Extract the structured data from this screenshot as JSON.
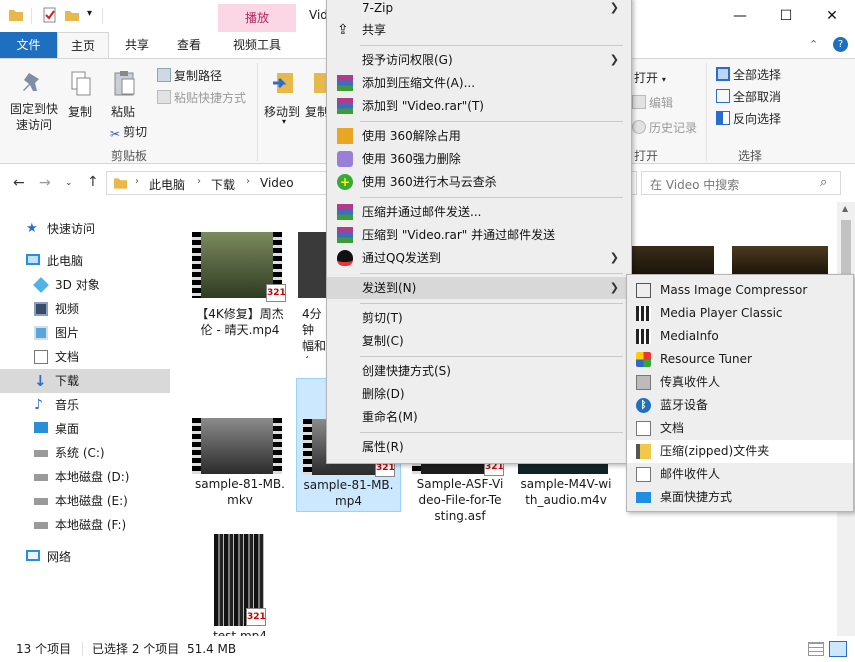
{
  "window": {
    "title": "Vid",
    "context_tab_group": "播放",
    "minimize": "—",
    "maximize": "☐",
    "close": "✕"
  },
  "ribbon_tabs": {
    "file": "文件",
    "home": "主页",
    "share": "共享",
    "view": "查看",
    "video_tools": "视频工具"
  },
  "ribbon": {
    "pin_quick_access": "固定到快速访问",
    "copy": "复制",
    "paste": "粘贴",
    "copy_path": "复制路径",
    "paste_shortcut": "粘贴快捷方式",
    "cut": "剪切",
    "clipboard_group": "剪贴板",
    "move_to": "移动到",
    "copy_to": "复制",
    "open": "打开",
    "edit": "编辑",
    "history": "历史记录",
    "open_group": "打开",
    "select_all": "全部选择",
    "select_none": "全部取消",
    "invert_selection": "反向选择",
    "select_group": "选择"
  },
  "address": {
    "crumbs": [
      "此电脑",
      "下载",
      "Video"
    ],
    "search_placeholder": "在 Video 中搜索"
  },
  "sidebar": {
    "items": [
      {
        "label": "快速访问",
        "icon": "star-icon"
      },
      {
        "label": "此电脑",
        "icon": "computer-icon"
      },
      {
        "label": "3D 对象",
        "icon": "cube-icon"
      },
      {
        "label": "视频",
        "icon": "video-folder-icon"
      },
      {
        "label": "图片",
        "icon": "picture-folder-icon"
      },
      {
        "label": "文档",
        "icon": "document-folder-icon"
      },
      {
        "label": "下载",
        "icon": "download-icon"
      },
      {
        "label": "音乐",
        "icon": "music-icon"
      },
      {
        "label": "桌面",
        "icon": "desktop-icon"
      },
      {
        "label": "系统 (C:)",
        "icon": "drive-icon"
      },
      {
        "label": "本地磁盘 (D:)",
        "icon": "drive-icon"
      },
      {
        "label": "本地磁盘 (E:)",
        "icon": "drive-icon"
      },
      {
        "label": "本地磁盘 (F:)",
        "icon": "drive-icon"
      },
      {
        "label": "网络",
        "icon": "network-icon"
      }
    ]
  },
  "files": [
    {
      "name_line1": "【4K修复】周杰",
      "name_line2": "伦 - 晴天.mp4",
      "name_line3": ""
    },
    {
      "name_line1": "4分钟",
      "name_line2": "幅和",
      "name_line3": "么"
    },
    {
      "name_line1": "sample-81-MB.",
      "name_line2": "mkv",
      "name_line3": ""
    },
    {
      "name_line1": "sample-81-MB.",
      "name_line2": "mp4",
      "name_line3": ""
    },
    {
      "name_line1": "Sample-ASF-Vi",
      "name_line2": "deo-File-for-Te",
      "name_line3": "sting.asf"
    },
    {
      "name_line1": "sample-M4V-wi",
      "name_line2": "th_audio.m4v",
      "name_line3": ""
    },
    {
      "name_line1": "test.mp4",
      "name_line2": "",
      "name_line3": ""
    }
  ],
  "badge_text": "321",
  "status": {
    "count": "13 个项目",
    "selected": "已选择 2 个项目",
    "size": "51.4 MB"
  },
  "context_menu": {
    "items": [
      {
        "label": "7-Zip",
        "arrow": "❯"
      },
      {
        "label": "共享"
      },
      {
        "label": "授予访问权限(G)",
        "arrow": "❯"
      },
      {
        "label": "添加到压缩文件(A)..."
      },
      {
        "label": "添加到 \"Video.rar\"(T)"
      },
      {
        "label": "使用 360解除占用"
      },
      {
        "label": "使用 360强力删除"
      },
      {
        "label": "使用 360进行木马云查杀"
      },
      {
        "label": "压缩并通过邮件发送..."
      },
      {
        "label": "压缩到 \"Video.rar\" 并通过邮件发送"
      },
      {
        "label": "通过QQ发送到",
        "arrow": "❯"
      },
      {
        "label": "发送到(N)",
        "arrow": "❯"
      },
      {
        "label": "剪切(T)"
      },
      {
        "label": "复制(C)"
      },
      {
        "label": "创建快捷方式(S)"
      },
      {
        "label": "删除(D)"
      },
      {
        "label": "重命名(M)"
      },
      {
        "label": "属性(R)"
      }
    ]
  },
  "sendto_menu": {
    "items": [
      {
        "label": "Mass Image Compressor"
      },
      {
        "label": "Media Player Classic"
      },
      {
        "label": "MediaInfo"
      },
      {
        "label": "Resource Tuner"
      },
      {
        "label": "传真收件人"
      },
      {
        "label": "蓝牙设备"
      },
      {
        "label": "文档"
      },
      {
        "label": "压缩(zipped)文件夹"
      },
      {
        "label": "邮件收件人"
      },
      {
        "label": "桌面快捷方式"
      }
    ]
  },
  "colors": {
    "accent": "#1e6fbf",
    "context_tab": "#fbd6e5",
    "selection": "#cce8ff",
    "menu_bg": "#eeeeee"
  }
}
